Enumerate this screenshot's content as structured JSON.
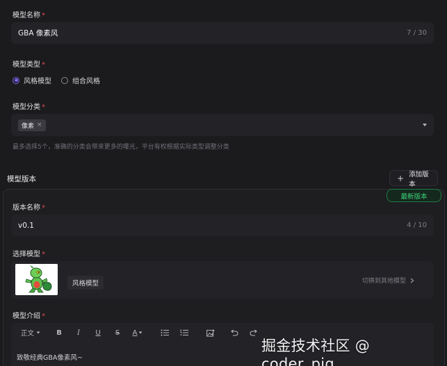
{
  "model_name": {
    "label": "模型名称",
    "required_mark": "*",
    "value": "GBA 像素风",
    "counter": "7 / 30"
  },
  "model_type": {
    "label": "模型类型",
    "required_mark": "*",
    "options": [
      {
        "label": "风格模型",
        "checked": true
      },
      {
        "label": "组合风格",
        "checked": false
      }
    ]
  },
  "model_category": {
    "label": "模型分类",
    "required_mark": "*",
    "tags": [
      {
        "label": "像素",
        "remove": "×"
      }
    ],
    "hint": "最多选择5个，准确的分类会带来更多的曝光，平台有权根据实际类型调整分类"
  },
  "versions": {
    "title": "模型版本",
    "add_button": {
      "icon": "+",
      "label": "添加版本"
    },
    "latest_badge": "最新版本",
    "version_name": {
      "label": "版本名称",
      "required_mark": "*",
      "value": "v0.1",
      "counter": "4 / 10"
    },
    "select_model": {
      "label": "选择模型",
      "required_mark": "*",
      "chip": "风格模型",
      "switch_link": "切换到其他模型",
      "switch_icon": "chevron-right-icon"
    },
    "model_intro": {
      "label": "模型介绍",
      "required_mark": "*",
      "toolbar": {
        "heading": "正文",
        "bold": "B",
        "italic": "I",
        "underline": "U",
        "strike": "S",
        "font_color": "A"
      },
      "content": "致敬经典GBA像素风~"
    }
  },
  "watermark": "掘金技术社区 @ coder_pig",
  "colors": {
    "accent": "#7d67f1",
    "required": "#e5484d",
    "latest_green": "#3ad07a",
    "background": "#1b1b1e"
  }
}
